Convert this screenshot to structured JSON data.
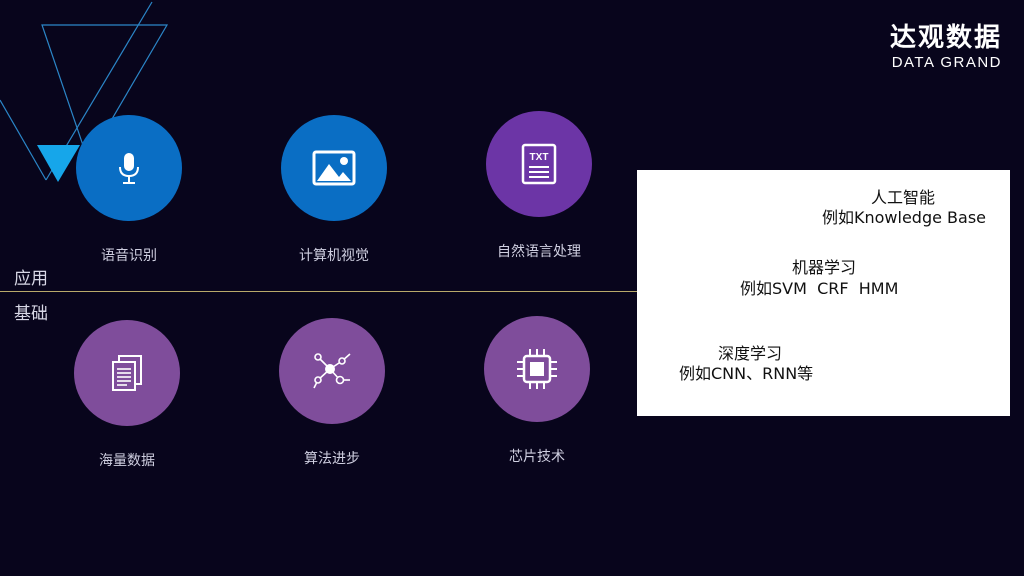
{
  "logo": {
    "cn": "达观数据",
    "en": "DATA GRAND"
  },
  "sections": {
    "application": "应用",
    "foundation": "基础"
  },
  "application_items": [
    {
      "label": "语音识别",
      "icon": "microphone-icon",
      "color": "#0a6ec4"
    },
    {
      "label": "计算机视觉",
      "icon": "image-icon",
      "color": "#0a6ec4"
    },
    {
      "label": "自然语言处理",
      "icon": "txt-document-icon",
      "color": "#6c35a6"
    }
  ],
  "foundation_items": [
    {
      "label": "海量数据",
      "icon": "documents-icon",
      "color": "#7f4d9b"
    },
    {
      "label": "算法进步",
      "icon": "network-nodes-icon",
      "color": "#7f4d9b"
    },
    {
      "label": "芯片技术",
      "icon": "chip-icon",
      "color": "#7f4d9b"
    }
  ],
  "info_box": {
    "ai": {
      "title": "人工智能",
      "example": "例如Knowledge Base"
    },
    "ml": {
      "title": "机器学习",
      "example": "例如SVM  CRF  HMM"
    },
    "dl": {
      "title": "深度学习",
      "example": "例如CNN、RNN等"
    }
  },
  "icon_text": {
    "txt": "TXT"
  }
}
